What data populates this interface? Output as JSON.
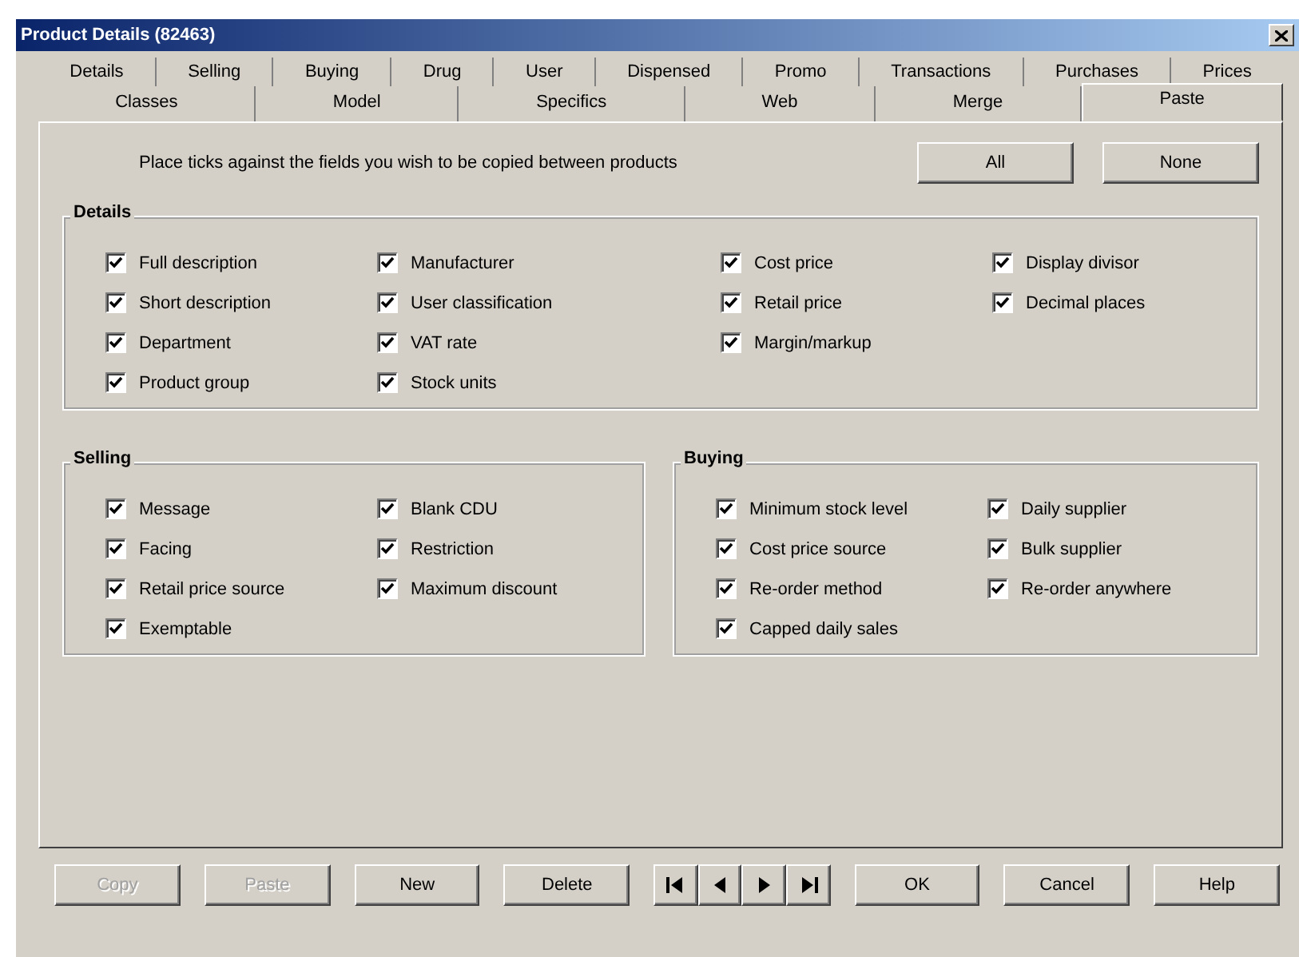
{
  "window": {
    "title": "Product Details (82463)"
  },
  "tab_rows": [
    [
      {
        "label": "Details",
        "selected": false
      },
      {
        "label": "Selling",
        "selected": false
      },
      {
        "label": "Buying",
        "selected": false
      },
      {
        "label": "Drug",
        "selected": false
      },
      {
        "label": "User",
        "selected": false
      },
      {
        "label": "Dispensed",
        "selected": false
      },
      {
        "label": "Promo",
        "selected": false
      },
      {
        "label": "Transactions",
        "selected": false
      },
      {
        "label": "Purchases",
        "selected": false
      },
      {
        "label": "Prices",
        "selected": false
      }
    ],
    [
      {
        "label": "Classes",
        "selected": false
      },
      {
        "label": "Model",
        "selected": false
      },
      {
        "label": "Specifics",
        "selected": false
      },
      {
        "label": "Web",
        "selected": false
      },
      {
        "label": "Merge",
        "selected": false
      },
      {
        "label": "Paste",
        "selected": true
      }
    ]
  ],
  "instruction": "Place ticks against the fields you wish to be copied between products",
  "select_buttons": [
    "All",
    "None"
  ],
  "groups": [
    {
      "title": "Details",
      "columns": [
        [
          {
            "label": "Full description",
            "checked": true
          },
          {
            "label": "Short description",
            "checked": true
          },
          {
            "label": "Department",
            "checked": true
          },
          {
            "label": "Product group",
            "checked": true
          }
        ],
        [
          {
            "label": "Manufacturer",
            "checked": true
          },
          {
            "label": "User classification",
            "checked": true
          },
          {
            "label": "VAT rate",
            "checked": true
          },
          {
            "label": "Stock units",
            "checked": true
          }
        ],
        [
          {
            "label": "Cost price",
            "checked": true
          },
          {
            "label": "Retail price",
            "checked": true
          },
          {
            "label": "Margin/markup",
            "checked": true
          }
        ],
        [
          {
            "label": "Display divisor",
            "checked": true
          },
          {
            "label": "Decimal places",
            "checked": true
          }
        ]
      ]
    },
    {
      "title": "Selling",
      "columns": [
        [
          {
            "label": "Message",
            "checked": true
          },
          {
            "label": "Facing",
            "checked": true
          },
          {
            "label": "Retail price source",
            "checked": true
          },
          {
            "label": "Exemptable",
            "checked": true
          }
        ],
        [
          {
            "label": "Blank CDU",
            "checked": true
          },
          {
            "label": "Restriction",
            "checked": true
          },
          {
            "label": "Maximum discount",
            "checked": true
          }
        ]
      ]
    },
    {
      "title": "Buying",
      "columns": [
        [
          {
            "label": "Minimum stock level",
            "checked": true
          },
          {
            "label": "Cost price source",
            "checked": true
          },
          {
            "label": "Re-order method",
            "checked": true
          },
          {
            "label": "Capped daily sales",
            "checked": true
          }
        ],
        [
          {
            "label": "Daily supplier",
            "checked": true
          },
          {
            "label": "Bulk supplier",
            "checked": true
          },
          {
            "label": "Re-order anywhere",
            "checked": true
          }
        ]
      ]
    }
  ],
  "footer_buttons": [
    {
      "kind": "text",
      "label": "Copy",
      "disabled": true
    },
    {
      "kind": "text",
      "label": "Paste",
      "disabled": true
    },
    {
      "kind": "text",
      "label": "New",
      "disabled": false
    },
    {
      "kind": "text",
      "label": "Delete",
      "disabled": false
    },
    {
      "kind": "first"
    },
    {
      "kind": "previous"
    },
    {
      "kind": "next"
    },
    {
      "kind": "last"
    },
    {
      "kind": "text",
      "label": "OK",
      "disabled": false
    },
    {
      "kind": "text",
      "label": "Cancel",
      "disabled": false
    },
    {
      "kind": "text",
      "label": "Help",
      "disabled": false
    }
  ]
}
